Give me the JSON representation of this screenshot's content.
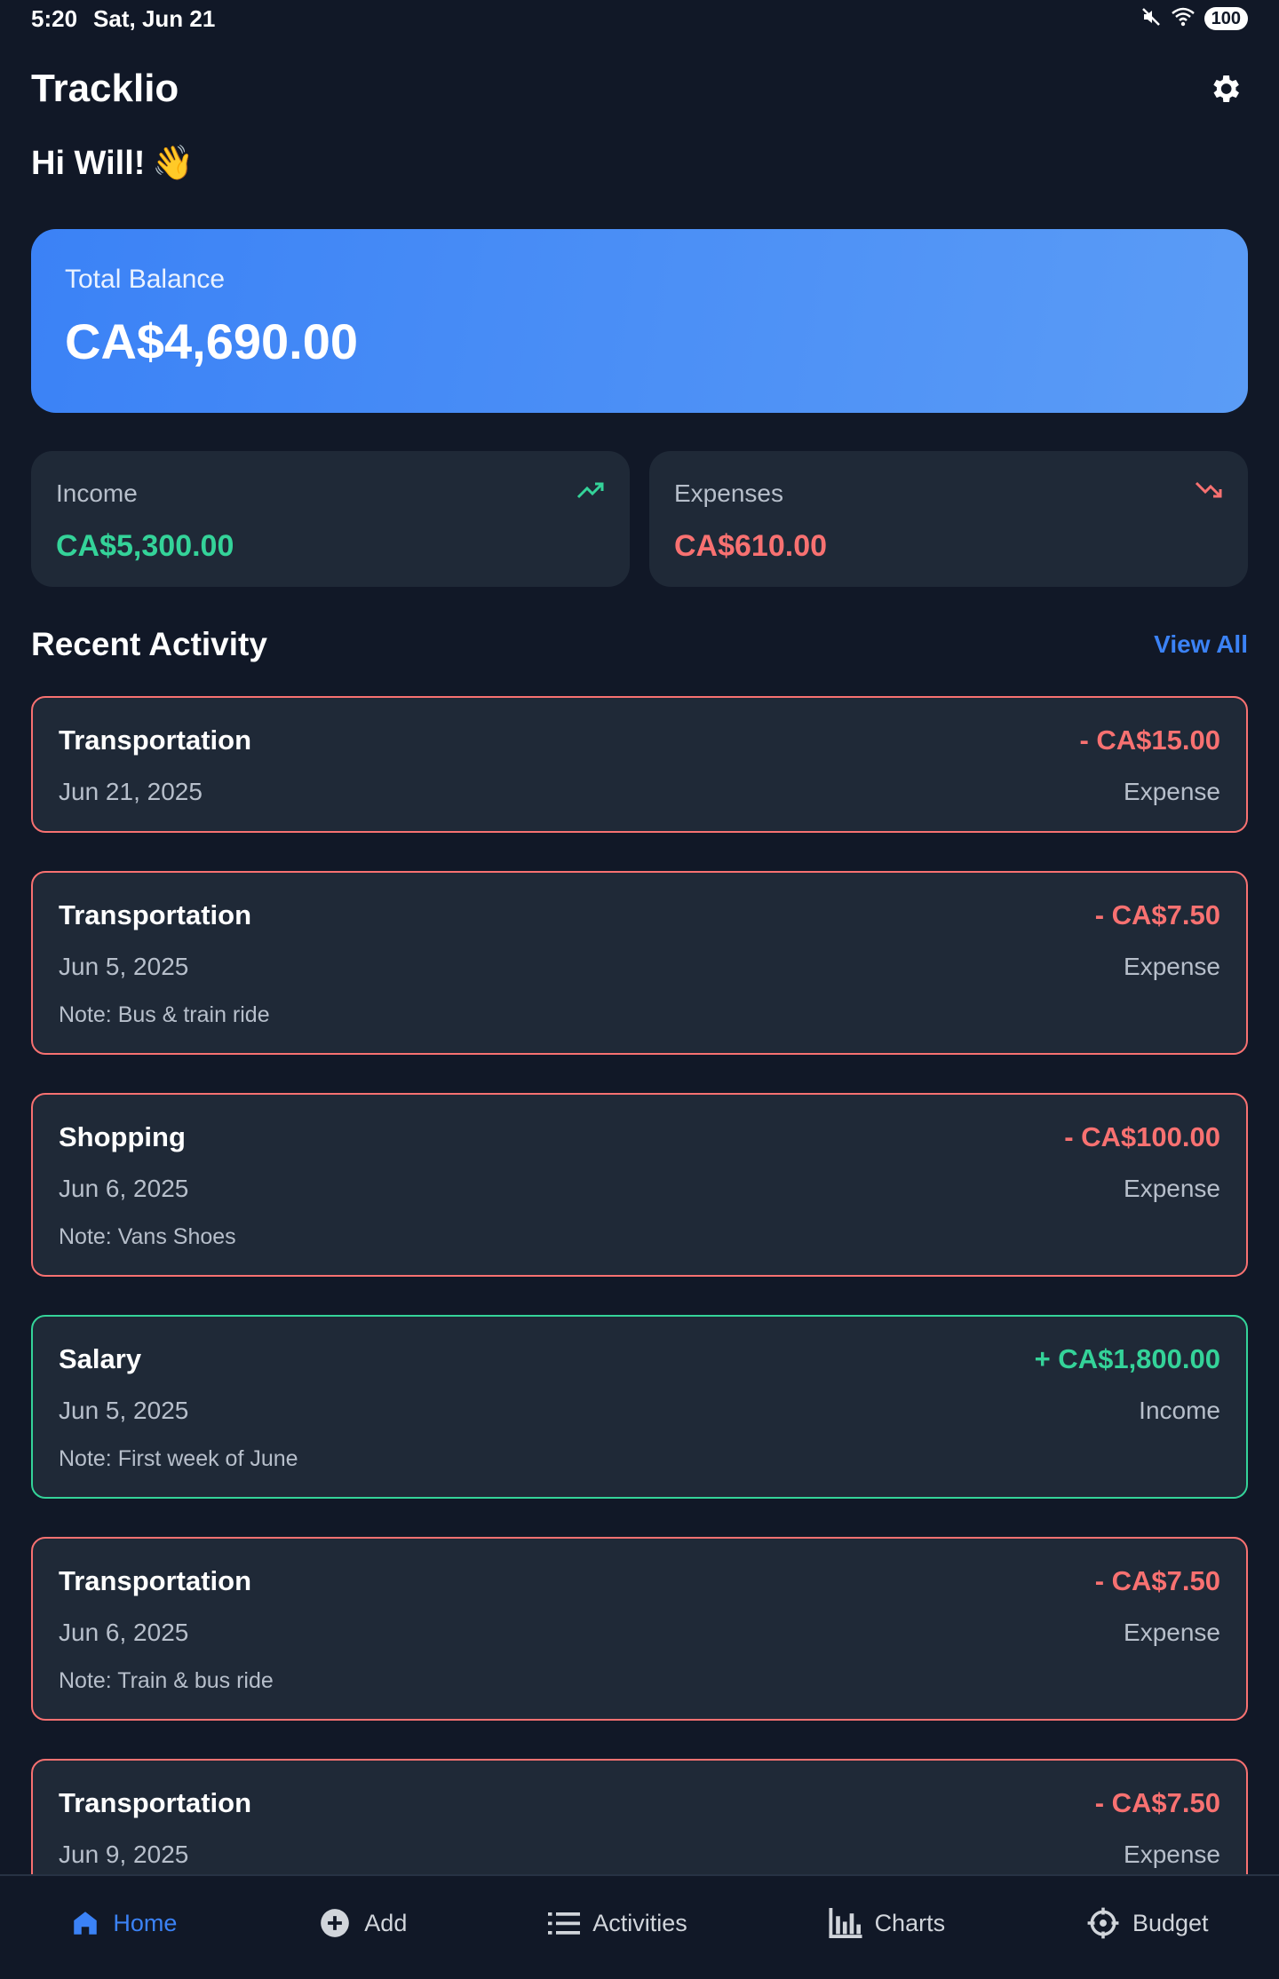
{
  "status_bar": {
    "time": "5:20",
    "date": "Sat, Jun 21",
    "battery": "100"
  },
  "header": {
    "title": "Tracklio"
  },
  "greeting": {
    "text": "Hi Will!",
    "emoji": "👋"
  },
  "balance": {
    "label": "Total Balance",
    "value": "CA$4,690.00"
  },
  "stats": {
    "income": {
      "label": "Income",
      "value": "CA$5,300.00",
      "icon": "trending-up-icon"
    },
    "expenses": {
      "label": "Expenses",
      "value": "CA$610.00",
      "icon": "trending-down-icon"
    }
  },
  "recent": {
    "title": "Recent Activity",
    "view_all": "View All"
  },
  "activities": [
    {
      "title": "Transportation",
      "amount": "- CA$15.00",
      "date": "Jun 21, 2025",
      "type": "Expense",
      "note": ""
    },
    {
      "title": "Transportation",
      "amount": "- CA$7.50",
      "date": "Jun 5, 2025",
      "type": "Expense",
      "note": "Note: Bus & train ride"
    },
    {
      "title": "Shopping",
      "amount": "- CA$100.00",
      "date": "Jun 6, 2025",
      "type": "Expense",
      "note": "Note: Vans Shoes"
    },
    {
      "title": "Salary",
      "amount": "+ CA$1,800.00",
      "date": "Jun 5, 2025",
      "type": "Income",
      "note": "Note: First week of June"
    },
    {
      "title": "Transportation",
      "amount": "- CA$7.50",
      "date": "Jun 6, 2025",
      "type": "Expense",
      "note": "Note: Train & bus ride"
    },
    {
      "title": "Transportation",
      "amount": "- CA$7.50",
      "date": "Jun 9, 2025",
      "type": "Expense",
      "note": ""
    }
  ],
  "nav": {
    "home": "Home",
    "add": "Add",
    "activities": "Activities",
    "charts": "Charts",
    "budget": "Budget"
  },
  "colors": {
    "background": "#111827",
    "card": "#1f2937",
    "accent": "#3b82f6",
    "income": "#34d399",
    "expense": "#f87171"
  }
}
